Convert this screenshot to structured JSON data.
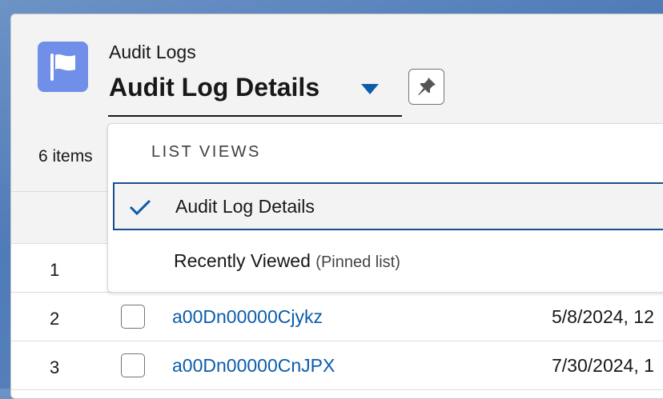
{
  "header": {
    "object_label": "Audit Logs",
    "list_view_title": "Audit Log Details",
    "item_count": "6 items",
    "icon": "flag-icon",
    "pin_icon": "pin-icon"
  },
  "list_views_menu": {
    "heading": "LIST VIEWS",
    "items": [
      {
        "label": "Audit Log Details",
        "sublabel": "",
        "selected": true
      },
      {
        "label": "Recently Viewed",
        "sublabel": "(Pinned list)",
        "selected": false
      }
    ]
  },
  "table": {
    "rows": [
      {
        "num": "1",
        "id": "",
        "date": ""
      },
      {
        "num": "2",
        "id": "a00Dn00000Cjykz",
        "date": "5/8/2024, 12"
      },
      {
        "num": "3",
        "id": "a00Dn00000CnJPX",
        "date": "7/30/2024, 1"
      }
    ]
  },
  "colors": {
    "accent": "#0b5cab",
    "icon_bg": "#6f8fe8",
    "selected_border": "#1b4f8c"
  }
}
